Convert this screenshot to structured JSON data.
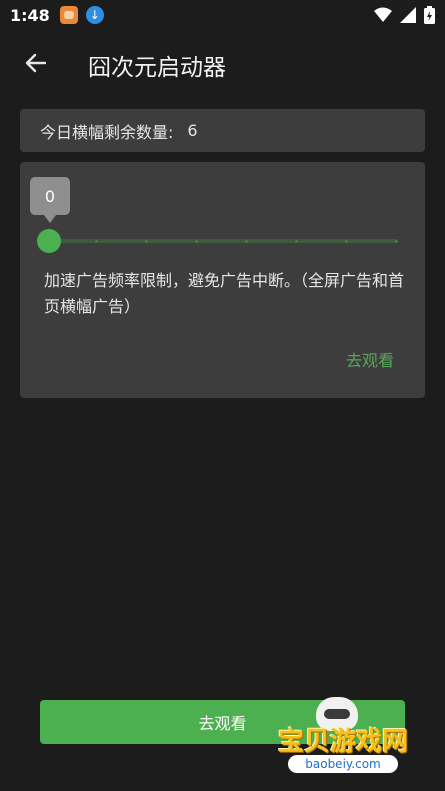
{
  "status_bar": {
    "time": "1:48",
    "icons": [
      "app-notification-icon",
      "download-icon",
      "wifi-icon",
      "signal-icon",
      "battery-charging-icon"
    ]
  },
  "app_bar": {
    "title": "囧次元启动器",
    "back_icon": "arrow-left-icon"
  },
  "count_card": {
    "label": "今日横幅剩余数量:",
    "value": "6"
  },
  "speed_card": {
    "slider": {
      "value": 0,
      "min": 0,
      "max": 7,
      "bubble_text": "0"
    },
    "description": "加速广告频率限制，避免广告中断。（全屏广告和首页横幅广告）",
    "watch_link": "去观看"
  },
  "bottom_button": {
    "label": "去观看"
  },
  "watermark": {
    "text": "宝贝游戏网",
    "url": "baobeiy.com"
  },
  "colors": {
    "background": "#1c1c1c",
    "card": "#3d3d3d",
    "accent": "#4caf50",
    "link": "#5aa55e"
  }
}
